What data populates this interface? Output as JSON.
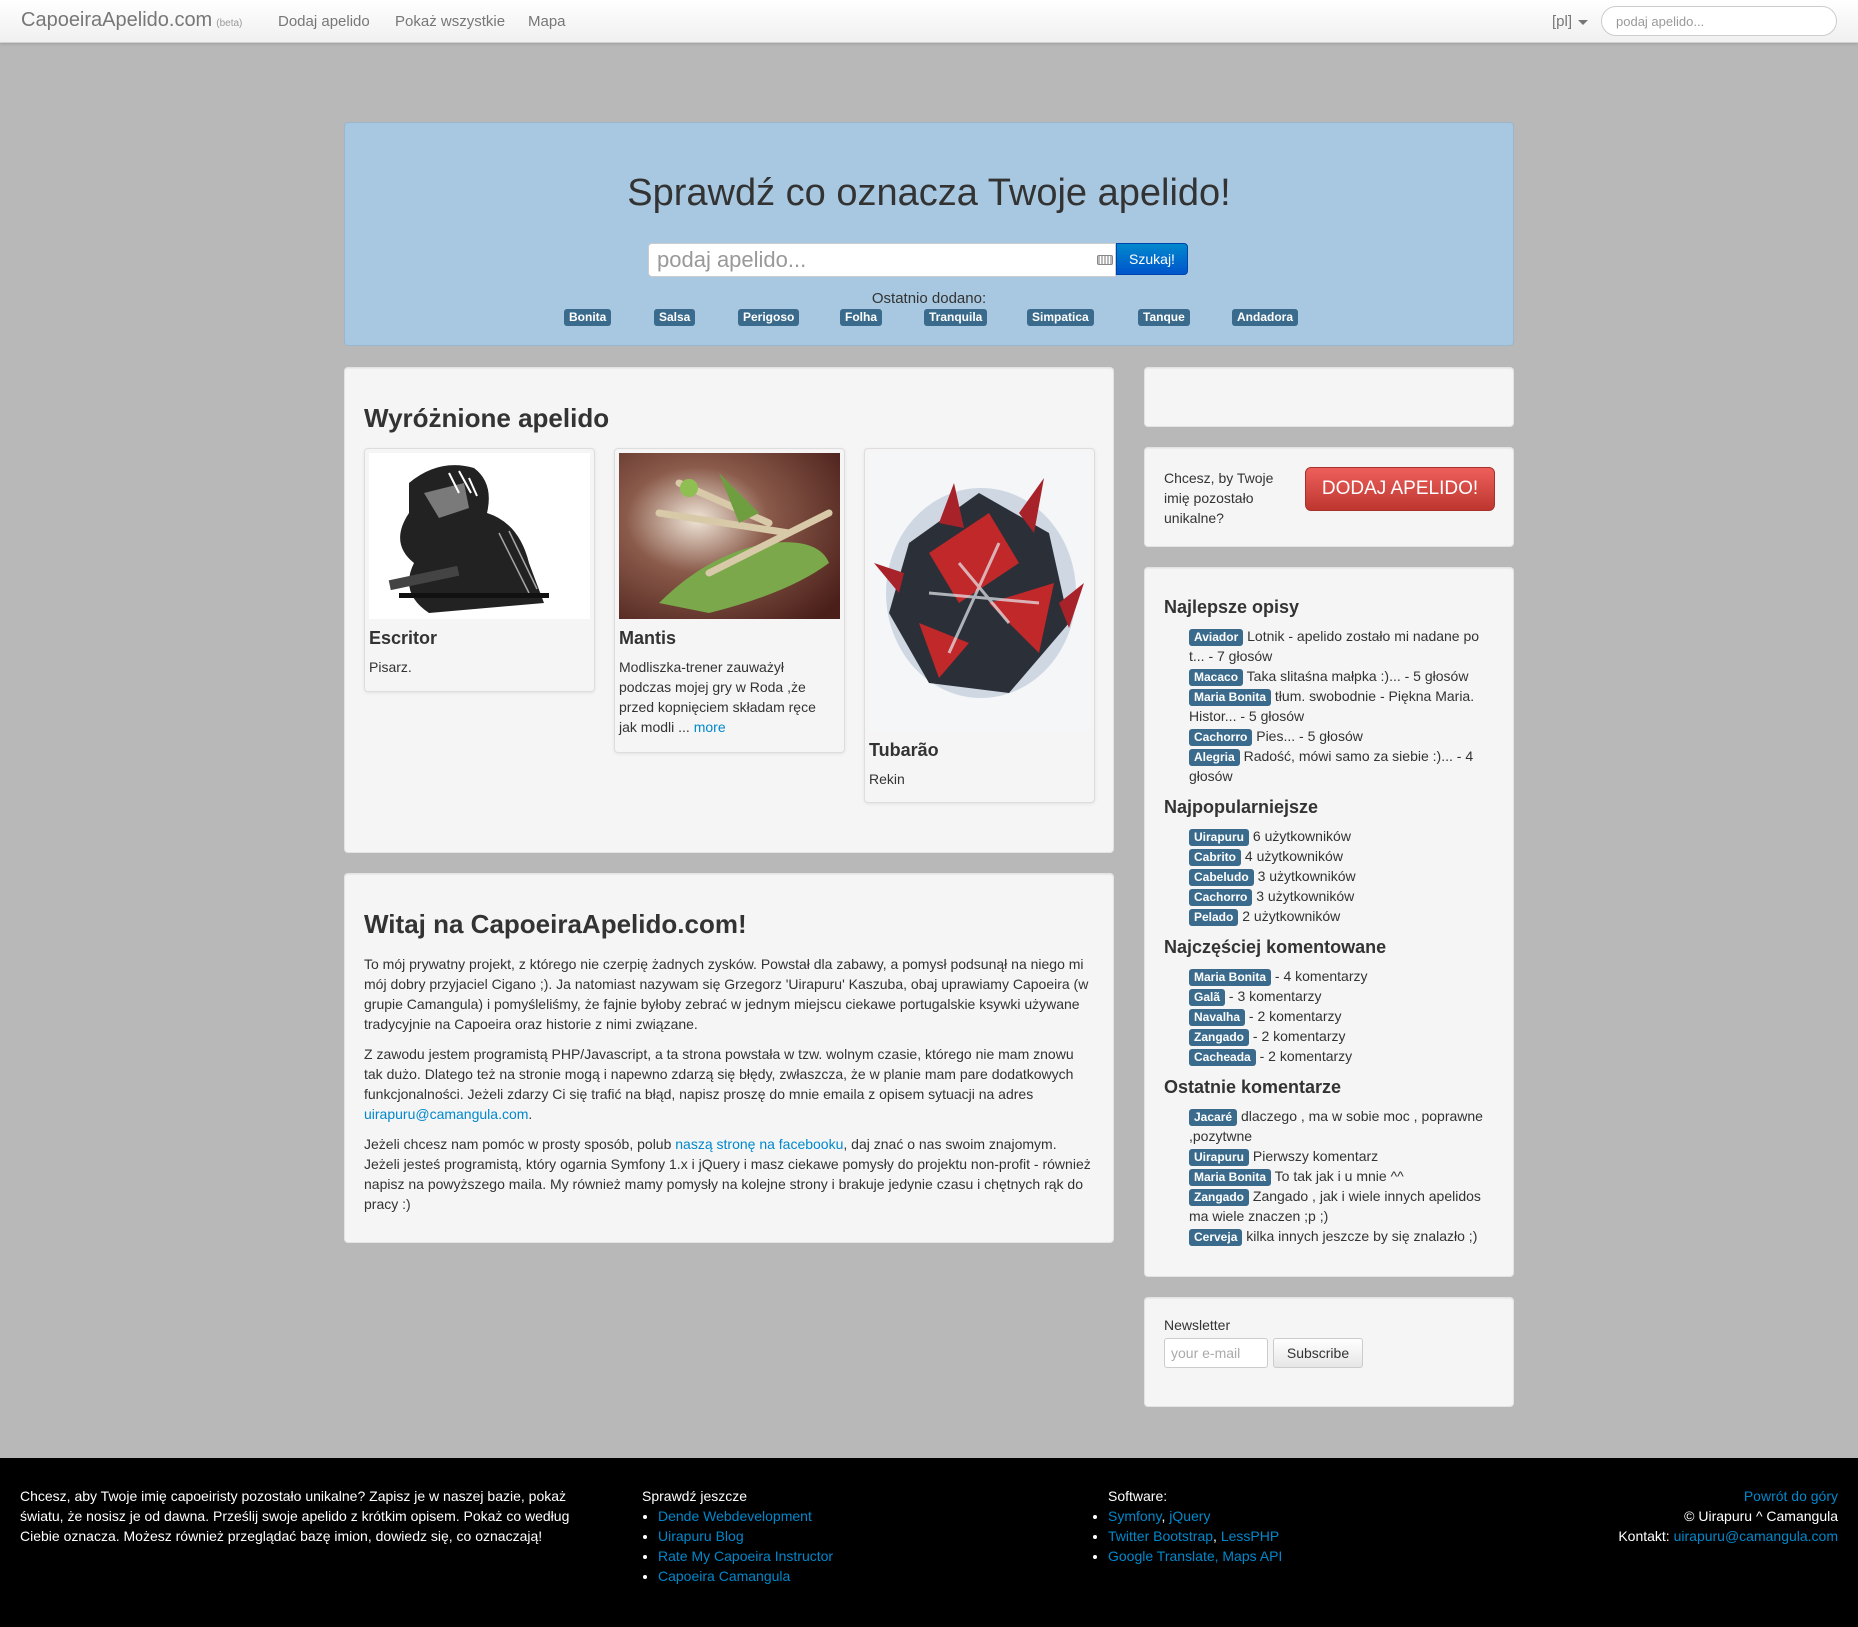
{
  "navbar": {
    "brand": "CapoeiraApelido.com",
    "brand_small": "(beta)",
    "links": [
      "Dodaj apelido",
      "Pokaż wszystkie",
      "Mapa"
    ],
    "lang": "[pl]",
    "search_placeholder": "podaj apelido..."
  },
  "hero": {
    "title": "Sprawdź co oznacza Twoje apelido!",
    "search_placeholder": "podaj apelido...",
    "search_button": "Szukaj!",
    "recent_label": "Ostatnio dodano:",
    "recent_tags": [
      "Bonita",
      "Salsa",
      "Perigoso",
      "Folha",
      "Tranquila",
      "Simpatica",
      "Tanque",
      "Andadora"
    ]
  },
  "featured": {
    "title": "Wyróżnione apelido",
    "items": [
      {
        "name": "Escritor",
        "desc": "Pisarz.",
        "more": ""
      },
      {
        "name": "Mantis",
        "desc": "Modliszka-trener zauważył podczas mojej gry w Roda ,że przed kopnięciem składam ręce jak modli ...",
        "more": "more"
      },
      {
        "name": "Tubarão",
        "desc": "Rekin",
        "more": ""
      }
    ]
  },
  "welcome": {
    "title": "Witaj na CapoeiraApelido.com!",
    "p1": "To mój prywatny projekt, z którego nie czerpię żadnych zysków. Powstał dla zabawy, a pomysł podsunął na niego mi mój dobry przyjaciel Cigano ;). Ja natomiast nazywam się Grzegorz 'Uirapuru' Kaszuba, obaj uprawiamy Capoeira (w grupie Camangula) i pomyśleliśmy, że fajnie byłoby zebrać w jednym miejscu ciekawe portugalskie ksywki używane tradycyjnie na Capoeira oraz historie z nimi związane.",
    "p2": "Z zawodu jestem programistą PHP/Javascript, a ta strona powstała w tzw. wolnym czasie, którego nie mam znowu tak dużo. Dlatego też na stronie mogą i napewno zdarzą się błędy, zwłaszcza, że w planie mam pare dodatkowych funkcjonalności. Jeżeli zdarzy Ci się trafić na błąd, napisz proszę do mnie emaila z opisem sytuacji na adres",
    "p2_link": "uirapuru@camangula.com",
    "p2_end": ".",
    "p3_a": "Jeżeli chcesz nam pomóc w prosty sposób, polub",
    "p3_link": "naszą stronę na facebooku",
    "p3_b": ", daj znać o nas swoim znajomym. Jeżeli jesteś programistą, który ogarnia Symfony 1.x i jQuery i masz ciekawe pomysły do projektu non-profit - również napisz na powyższego maila. My również mamy pomysły na kolejne strony i brakuje jedynie czasu i chętnych rąk do pracy :)"
  },
  "sidebar": {
    "cta_text": "Chcesz, by Twoje imię pozostało unikalne?",
    "cta_button": "DODAJ APELIDO!",
    "best": {
      "title": "Najlepsze opisy",
      "items": [
        {
          "tag": "Aviador",
          "text": "Lotnik - apelido zostało mi nadane po t... - 7 głosów"
        },
        {
          "tag": "Macaco",
          "text": "Taka slitaśna małpka :)... - 5 głosów"
        },
        {
          "tag": "Maria Bonita",
          "text": "tłum. swobodnie - Piękna Maria. Histor... - 5 głosów"
        },
        {
          "tag": "Cachorro",
          "text": "Pies... - 5 głosów"
        },
        {
          "tag": "Alegria",
          "text": "Radość, mówi samo za siebie :)... - 4 głosów"
        }
      ]
    },
    "popular": {
      "title": "Najpopularniejsze",
      "items": [
        {
          "tag": "Uirapuru",
          "text": "6 użytkowników"
        },
        {
          "tag": "Cabrito",
          "text": "4 użytkowników"
        },
        {
          "tag": "Cabeludo",
          "text": "3 użytkowników"
        },
        {
          "tag": "Cachorro",
          "text": "3 użytkowników"
        },
        {
          "tag": "Pelado",
          "text": "2 użytkowników"
        }
      ]
    },
    "commented": {
      "title": "Najczęściej komentowane",
      "items": [
        {
          "tag": "Maria Bonita",
          "text": "- 4 komentarzy"
        },
        {
          "tag": "Galã",
          "text": "- 3 komentarzy"
        },
        {
          "tag": "Navalha",
          "text": "- 2 komentarzy"
        },
        {
          "tag": "Zangado",
          "text": "- 2 komentarzy"
        },
        {
          "tag": "Cacheada",
          "text": "- 2 komentarzy"
        }
      ]
    },
    "latest": {
      "title": "Ostatnie komentarze",
      "items": [
        {
          "tag": "Jacaré",
          "text": "dlaczego , ma w sobie moc , poprawne ,pozytwne"
        },
        {
          "tag": "Uirapuru",
          "text": "Pierwszy komentarz"
        },
        {
          "tag": "Maria Bonita",
          "text": "To tak jak i u mnie ^^"
        },
        {
          "tag": "Zangado",
          "text": "Zangado , jak i wiele innych apelidos ma wiele znaczen ;p ;)"
        },
        {
          "tag": "Cerveja",
          "text": "kilka innych jeszcze by się znalazło ;)"
        }
      ]
    },
    "newsletter": {
      "label": "Newsletter",
      "placeholder": "your e-mail",
      "button": "Subscribe"
    }
  },
  "footer": {
    "about": "Chcesz, aby Twoje imię capoeiristy pozostało unikalne? Zapisz je w naszej bazie, pokaż światu, że nosisz je od dawna. Prześlij swoje apelido z krótkim opisem. Pokaż co według Ciebie oznacza. Możesz również przeglądać bazę imion, dowiedz się, co oznaczają!",
    "check_title": "Sprawdź jeszcze",
    "check_links": [
      "Dende Webdevelopment",
      "Uirapuru Blog",
      "Rate My Capoeira Instructor",
      "Capoeira Camangula"
    ],
    "software_title": "Software:",
    "software": [
      {
        "a": "Symfony",
        "sep": ", ",
        "b": "jQuery"
      },
      {
        "a": "Twitter Bootstrap",
        "sep": ", ",
        "b": "LessPHP"
      },
      {
        "a": "Google Translate, Maps API",
        "sep": "",
        "b": ""
      }
    ],
    "back_top": "Powrót do góry",
    "copyright": "© Uirapuru ^ Camangula",
    "contact_label": "Kontakt:",
    "contact_email": "uirapuru@camangula.com"
  },
  "colors": {
    "page_bg": "#b8b8b8",
    "hero_bg": "#a7c8e0",
    "tag_bg": "#3a6b8c",
    "link": "#0088cc",
    "danger": "#da4f49"
  }
}
